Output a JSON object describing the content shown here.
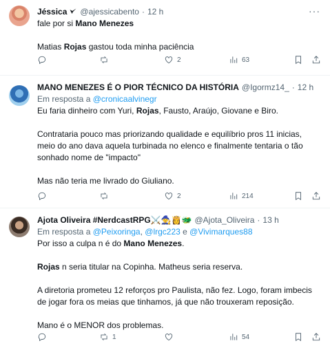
{
  "tweets": [
    {
      "name": "Jéssica",
      "handle": "@ajessicabento",
      "time": "12 h",
      "lines": [
        [
          {
            "t": "fale por si "
          },
          {
            "t": "Mano Menezes",
            "b": true
          }
        ],
        [],
        [
          {
            "t": "Matias "
          },
          {
            "t": "Rojas",
            "b": true
          },
          {
            "t": " gastou toda minha paciência"
          }
        ]
      ],
      "stats": {
        "replies": "",
        "retweets": "",
        "likes": "2",
        "views": "63"
      }
    },
    {
      "name": "MANO MENEZES É O PIOR TÉCNICO DA HISTÓRIA",
      "handle": "@Igormz14_",
      "time": "12 h",
      "reply_to_label": "Em resposta a ",
      "reply_to": [
        "@cronicaalvinegr"
      ],
      "lines": [
        [
          {
            "t": "Eu faria dinheiro com Yuri, "
          },
          {
            "t": "Rojas",
            "b": true
          },
          {
            "t": ", Fausto, Araújo, Giovane e Biro."
          }
        ],
        [],
        [
          {
            "t": "Contrataria pouco mas priorizando qualidade e equilíbrio pros 11 inicias,"
          }
        ],
        [
          {
            "t": "meio do ano dava aquela turbinada no elenco e finalmente tentaria o tão"
          }
        ],
        [
          {
            "t": "sonhado nome de \"impacto\""
          }
        ],
        [],
        [
          {
            "t": "Mas não teria me livrado do Giuliano."
          }
        ]
      ],
      "stats": {
        "replies": "",
        "retweets": "",
        "likes": "2",
        "views": "214"
      }
    },
    {
      "name": "Ajota Oliveira #NerdcastRPG⚔️🧙👸🐲",
      "handle": "@Ajota_Oliveira",
      "time": "13 h",
      "reply_to_label": "Em resposta a ",
      "reply_to": [
        "@Peixoringa",
        "@lrgc223",
        "@Vivimarques88"
      ],
      "reply_sep": ", ",
      "reply_and": " e ",
      "lines": [
        [
          {
            "t": "Por isso a culpa n é do "
          },
          {
            "t": "Mano Menezes",
            "b": true
          },
          {
            "t": "."
          }
        ],
        [],
        [
          {
            "t": "Rojas",
            "b": true
          },
          {
            "t": " n seria titular na Copinha. Matheus seria reserva."
          }
        ],
        [],
        [
          {
            "t": "A diretoria prometeu 12 reforços pro Paulista, não fez. Logo, foram imbecis"
          }
        ],
        [
          {
            "t": "de jogar fora os meias que tinhamos, já que não trouxeram reposição."
          }
        ],
        [],
        [
          {
            "t": "Mano é o MENOR dos problemas."
          }
        ]
      ],
      "stats": {
        "replies": "",
        "retweets": "1",
        "likes": "",
        "views": "54"
      }
    }
  ],
  "icons": {
    "more": "more-icon",
    "verified": "verified-icon",
    "reply": "reply-icon",
    "retweet": "retweet-icon",
    "like": "like-icon",
    "views": "views-icon",
    "bookmark": "bookmark-icon",
    "share": "share-icon"
  },
  "colors": {
    "accent": "#1d9bf0",
    "muted": "#536471",
    "text": "#0f1419",
    "divider": "#eff3f4"
  }
}
